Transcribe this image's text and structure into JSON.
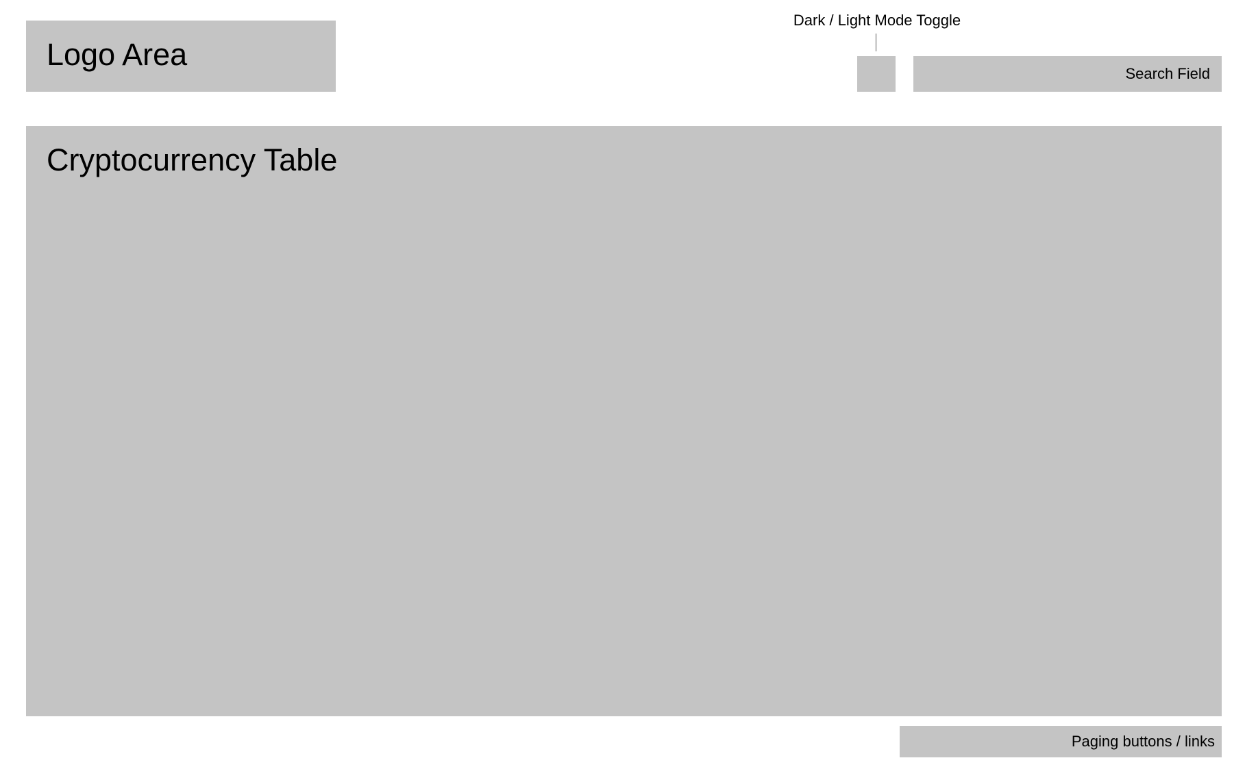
{
  "header": {
    "logo_label": "Logo Area",
    "toggle_caption": "Dark / Light Mode Toggle",
    "search": {
      "placeholder": "Search Field"
    }
  },
  "main": {
    "table_title": "Cryptocurrency Table"
  },
  "footer": {
    "paging_label": "Paging buttons / links"
  },
  "colors": {
    "placeholder_block": "#c4c4c4",
    "background": "#ffffff",
    "text": "#000000"
  }
}
